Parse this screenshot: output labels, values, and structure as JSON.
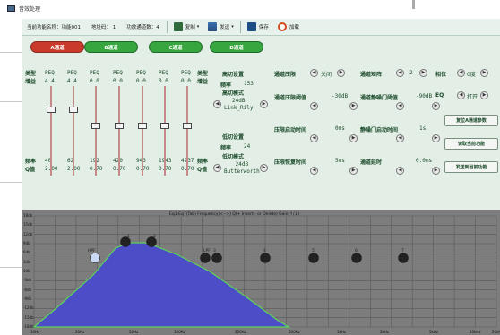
{
  "window": {
    "title": "音效处理"
  },
  "toolbar": {
    "func_name": "当前功能名称：功能001",
    "address": "地址码： 1",
    "channels": "功放通道数：4",
    "copy_label": "复制",
    "send_label": "发送",
    "save_label": "保存",
    "load_label": "加载"
  },
  "channels": [
    {
      "label": "A通道"
    },
    {
      "label": "B通道"
    },
    {
      "label": "C通道"
    },
    {
      "label": "D通道"
    }
  ],
  "eq": {
    "type_label": "类型\n增益",
    "freq_label": "频率\nQ值",
    "bands": [
      {
        "type": "PEQ",
        "gain": "4.4",
        "freq": "40",
        "q": "2.00",
        "level": 0.75
      },
      {
        "type": "PEQ",
        "gain": "4.4",
        "freq": "62",
        "q": "2.00",
        "level": 0.75
      },
      {
        "type": "PEQ",
        "gain": "0.0",
        "freq": "192",
        "q": "0.70",
        "level": 0.5
      },
      {
        "type": "PEQ",
        "gain": "0.0",
        "freq": "420",
        "q": "0.70",
        "level": 0.5
      },
      {
        "type": "PEQ",
        "gain": "0.0",
        "freq": "943",
        "q": "0.70",
        "level": 0.5
      },
      {
        "type": "PEQ",
        "gain": "0.0",
        "freq": "1943",
        "q": "0.70",
        "level": 0.5
      },
      {
        "type": "PEQ",
        "gain": "0.0",
        "freq": "4237",
        "q": "0.70",
        "level": 0.5
      }
    ],
    "extra_type_label": "类型\n增益",
    "extra_freq_label": "频率\nQ值"
  },
  "highcut": {
    "title": "高切设置",
    "freq_label": "频率",
    "freq_value": "153",
    "mode_label": "高切模式",
    "mode_value": "24dB\nLink_Rily"
  },
  "lowcut": {
    "title": "低切设置",
    "freq_label": "频率",
    "freq_value": "24",
    "mode_label": "低切模式",
    "mode_value": "24dB\nButterworth"
  },
  "right": {
    "compressor_label": "通道压限",
    "compressor_state": "关闭",
    "matrix_label": "通道矩阵",
    "matrix_value": "2",
    "phase_label": "相位",
    "phase_value": "0度",
    "eq_label": "EQ",
    "eq_state": "打开",
    "threshold_label": "通道压限阈值",
    "threshold_value": "-30dB",
    "gate_threshold_label": "通道静噪门阈值",
    "gate_threshold_value": "-90dB",
    "attack_label": "压限启动时间",
    "attack_value": "0ms",
    "gate_attack_label": "静噪门启动时间",
    "gate_attack_value": "1s",
    "release_label": "压限恢复时间",
    "release_value": "5ms",
    "delay_label": "通道延时",
    "delay_value": "0.0ms"
  },
  "actions": {
    "reset": "复位A通道参数",
    "read": "读取当前功能",
    "send": "发送到当前功能"
  },
  "graph": {
    "title": "Eq1-Eq7(Tab) Frequency(<-->) Q(+ Insert - or Delete) Gain(↑/↓)",
    "y_ticks": [
      "18db",
      "15db",
      "12db",
      "9db",
      "6db",
      "3db",
      "0db",
      "-3db",
      "-6db",
      "-9db",
      "-12db",
      "-15db",
      "-18db"
    ],
    "x_ticks": [
      "10Hz",
      "20Hz",
      "50Hz",
      "100Hz",
      "200Hz",
      "500Hz",
      "1kHz",
      "2kHz",
      "5kHz",
      "10kHz",
      "20kHz"
    ],
    "points": [
      {
        "label": "HPF"
      },
      {
        "label": "1"
      },
      {
        "label": "2"
      },
      {
        "label": "LPF"
      },
      {
        "label": "3"
      },
      {
        "label": "4"
      },
      {
        "label": "5"
      },
      {
        "label": "6"
      },
      {
        "label": "7"
      }
    ],
    "colors": {
      "fill": "#4d4dc8",
      "curve": "#5cd35c",
      "bg": "#7d7d7d",
      "grid": "#5a5a5a"
    }
  }
}
